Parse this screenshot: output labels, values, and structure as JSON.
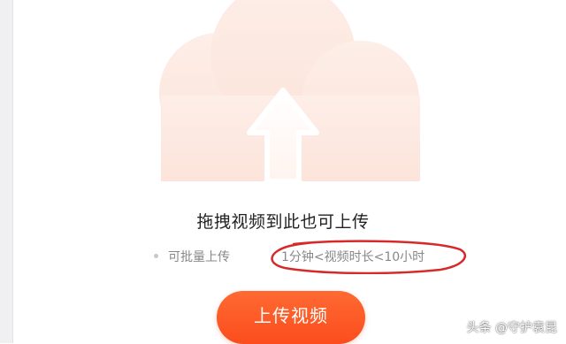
{
  "upload_area": {
    "drop_title": "拖拽视频到此也可上传",
    "hint_batch": "可批量上传",
    "hint_limit": "1分钟<视频时长<10小时",
    "upload_button_label": "上传视频",
    "cloud_icon": "cloud-upload-icon"
  },
  "watermark": {
    "text": "头条 @守护袁昆"
  },
  "colors": {
    "accent": "#ff5c2a",
    "annotation": "#d62a2a",
    "cloud": "#fde9e2"
  }
}
